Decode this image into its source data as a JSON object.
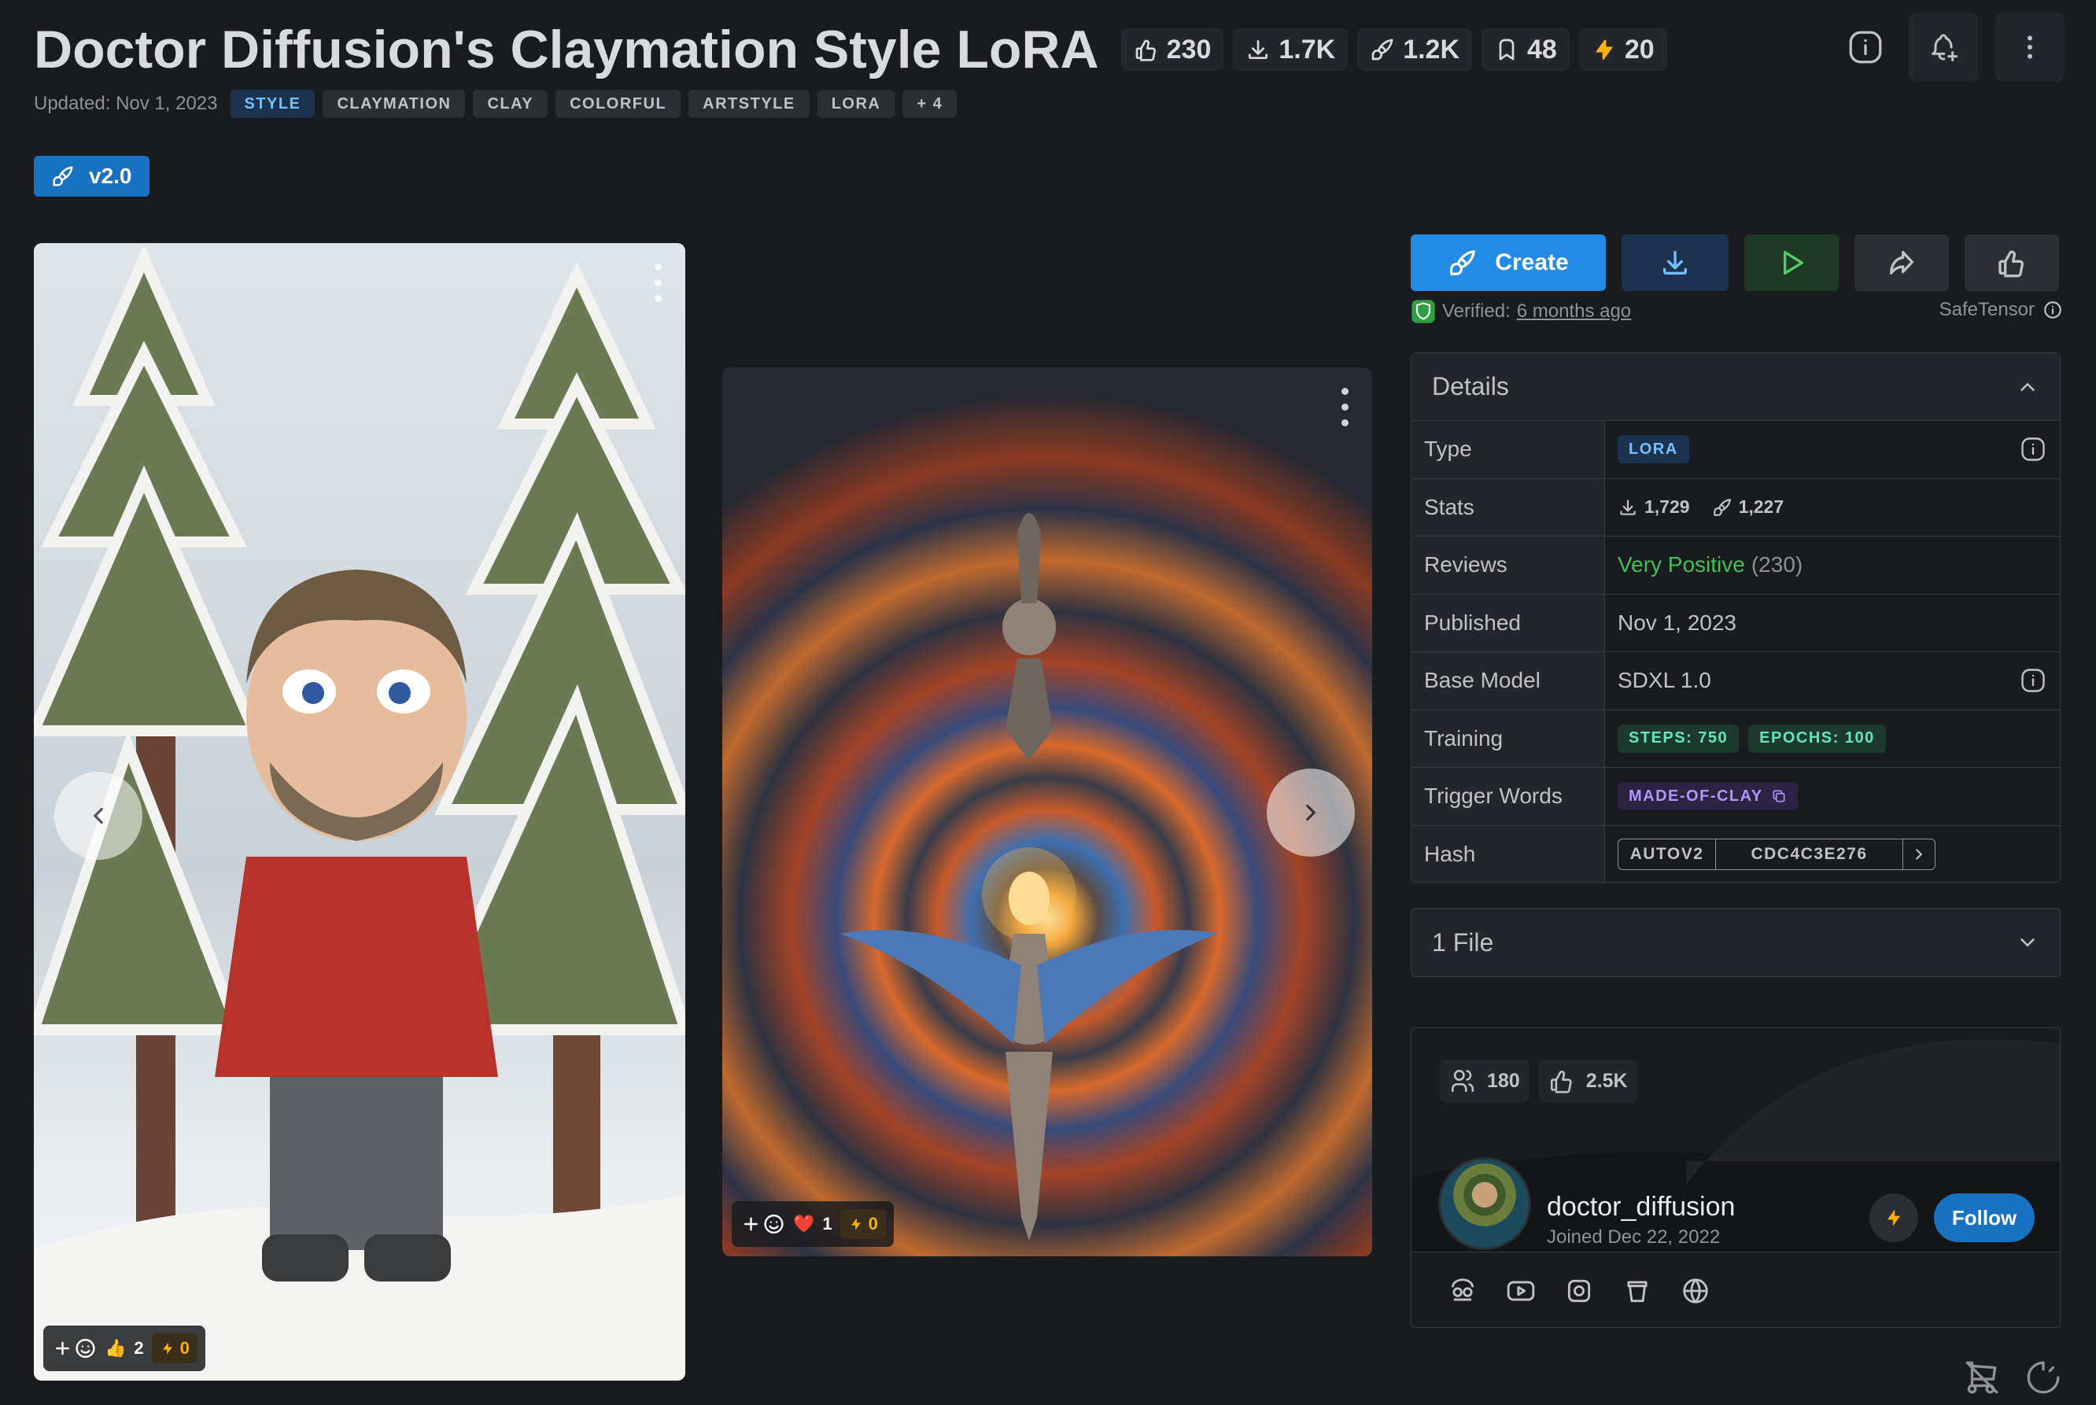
{
  "header": {
    "title": "Doctor Diffusion's Claymation Style LoRA",
    "stats": [
      {
        "icon": "thumbs-up-icon",
        "value": "230"
      },
      {
        "icon": "download-icon",
        "value": "1.7K"
      },
      {
        "icon": "brush-icon",
        "value": "1.2K"
      },
      {
        "icon": "bookmark-icon",
        "value": "48"
      },
      {
        "icon": "bolt-icon",
        "value": "20"
      }
    ],
    "updated": "Updated: Nov 1, 2023",
    "tags": [
      "STYLE",
      "CLAYMATION",
      "CLAY",
      "COLORFUL",
      "ARTSTYLE",
      "LORA",
      "+ 4"
    ],
    "version": "v2.0"
  },
  "gallery": {
    "card1": {
      "reaction_count": "2",
      "buzz": "0",
      "reaction_emoji": "👍"
    },
    "card2": {
      "reaction_count": "1",
      "buzz": "0",
      "reaction_emoji": "❤️"
    }
  },
  "actions": {
    "create_label": "Create"
  },
  "verify": {
    "prefix": "Verified:",
    "link": "6 months ago",
    "safetensor": "SafeTensor"
  },
  "details": {
    "heading": "Details",
    "rows": {
      "type": {
        "label": "Type",
        "value": "LORA"
      },
      "stats": {
        "label": "Stats",
        "downloads": "1,729",
        "generations": "1,227"
      },
      "reviews": {
        "label": "Reviews",
        "rating": "Very Positive",
        "count": "(230)"
      },
      "published": {
        "label": "Published",
        "value": "Nov 1, 2023"
      },
      "base_model": {
        "label": "Base Model",
        "value": "SDXL 1.0"
      },
      "training": {
        "label": "Training",
        "steps": "STEPS: 750",
        "epochs": "EPOCHS: 100"
      },
      "trigger": {
        "label": "Trigger Words",
        "value": "MADE-OF-CLAY"
      },
      "hash": {
        "label": "Hash",
        "algo": "AUTOV2",
        "value": "CDC4C3E276"
      }
    }
  },
  "files": {
    "label": "1 File"
  },
  "creator": {
    "followers": "180",
    "likes": "2.5K",
    "name": "doctor_diffusion",
    "joined": "Joined Dec 22, 2022",
    "follow_label": "Follow",
    "links": [
      "civitai-icon",
      "youtube-icon",
      "instagram-icon",
      "coffee-icon",
      "globe-icon"
    ]
  },
  "colors": {
    "accent": "#228be6",
    "background": "#1a1b1e",
    "positive": "#40c057",
    "buzz": "#fab005"
  }
}
